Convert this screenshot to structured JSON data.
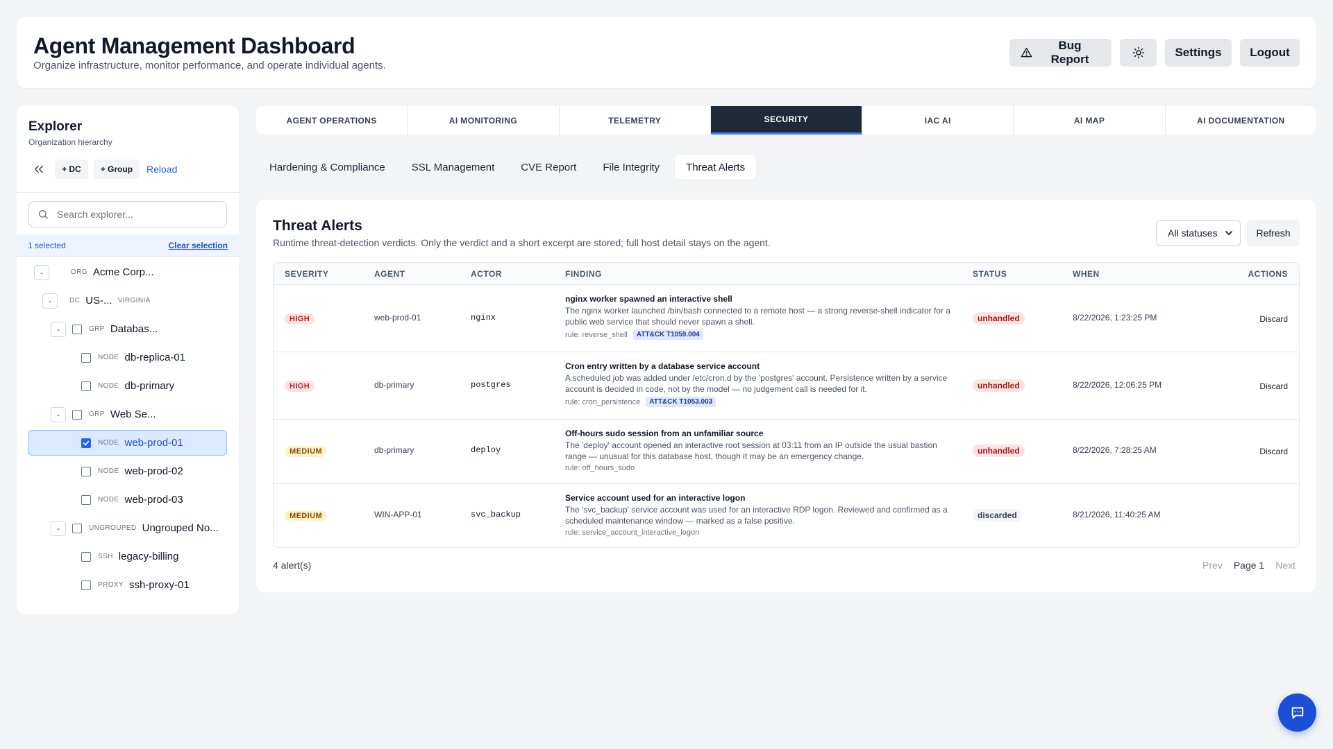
{
  "header": {
    "title": "Agent Management Dashboard",
    "subtitle": "Organize infrastructure, monitor performance, and operate individual agents.",
    "bug_report": "Bug Report",
    "settings": "Settings",
    "logout": "Logout"
  },
  "explorer": {
    "title": "Explorer",
    "subtitle": "Organization hierarchy",
    "add_dc": "+ DC",
    "add_group": "+ Group",
    "reload": "Reload",
    "search_placeholder": "Search explorer...",
    "selected_count": "1 selected",
    "clear_selection": "Clear selection",
    "tree": [
      {
        "type": "ORG",
        "name": "Acme Corp..."
      },
      {
        "type": "DC",
        "name": "US-...",
        "suffix": "VIRGINIA"
      },
      {
        "type": "GRP",
        "name": "Databas..."
      },
      {
        "type": "NODE",
        "name": "db-replica-01"
      },
      {
        "type": "NODE",
        "name": "db-primary"
      },
      {
        "type": "GRP",
        "name": "Web Se..."
      },
      {
        "type": "NODE",
        "name": "web-prod-01"
      },
      {
        "type": "NODE",
        "name": "web-prod-02"
      },
      {
        "type": "NODE",
        "name": "web-prod-03"
      },
      {
        "type": "UNGROUPED",
        "name": "Ungrouped No..."
      },
      {
        "type": "SSH",
        "name": "legacy-billing"
      },
      {
        "type": "PROXY",
        "name": "ssh-proxy-01"
      }
    ]
  },
  "tabs": [
    "AGENT OPERATIONS",
    "AI MONITORING",
    "TELEMETRY",
    "SECURITY",
    "IAC AI",
    "AI MAP",
    "AI DOCUMENTATION"
  ],
  "subtabs": [
    "Hardening & Compliance",
    "SSL Management",
    "CVE Report",
    "File Integrity",
    "Threat Alerts"
  ],
  "panel": {
    "title": "Threat Alerts",
    "subtitle": "Runtime threat-detection verdicts. Only the verdict and a short excerpt are stored; full host detail stays on the agent.",
    "status_filter": "All statuses",
    "refresh": "Refresh",
    "columns": [
      "SEVERITY",
      "AGENT",
      "ACTOR",
      "FINDING",
      "STATUS",
      "WHEN",
      "ACTIONS"
    ],
    "rows": [
      {
        "severity": "HIGH",
        "agent": "web-prod-01",
        "actor": "nginx",
        "title": "nginx worker spawned an interactive shell",
        "desc": "The nginx worker launched /bin/bash connected to a remote host — a strong reverse-shell indicator for a public web service that should never spawn a shell.",
        "rule": "rule: reverse_shell",
        "attack": "ATT&CK T1059.004",
        "status": "unhandled",
        "when": "8/22/2026, 1:23:25 PM",
        "action": "Discard"
      },
      {
        "severity": "HIGH",
        "agent": "db-primary",
        "actor": "postgres",
        "title": "Cron entry written by a database service account",
        "desc": "A scheduled job was added under /etc/cron.d by the 'postgres' account. Persistence written by a service account is decided in code, not by the model — no judgement call is needed for it.",
        "rule": "rule: cron_persistence",
        "attack": "ATT&CK T1053.003",
        "status": "unhandled",
        "when": "8/22/2026, 12:06:25 PM",
        "action": "Discard"
      },
      {
        "severity": "MEDIUM",
        "agent": "db-primary",
        "actor": "deploy",
        "title": "Off-hours sudo session from an unfamiliar source",
        "desc": "The 'deploy' account opened an interactive root session at 03:11 from an IP outside the usual bastion range — unusual for this database host, though it may be an emergency change.",
        "rule": "rule: off_hours_sudo",
        "attack": "",
        "status": "unhandled",
        "when": "8/22/2026, 7:28:25 AM",
        "action": "Discard"
      },
      {
        "severity": "MEDIUM",
        "agent": "WIN-APP-01",
        "actor": "svc_backup",
        "title": "Service account used for an interactive logon",
        "desc": "The 'svc_backup' service account was used for an interactive RDP logon. Reviewed and confirmed as a scheduled maintenance window — marked as a false positive.",
        "rule": "rule: service_account_interactive_logon",
        "attack": "",
        "status": "discarded",
        "when": "8/21/2026, 11:40:25 AM",
        "action": ""
      }
    ],
    "count": "4 alert(s)",
    "prev": "Prev",
    "page": "Page 1",
    "next": "Next"
  }
}
